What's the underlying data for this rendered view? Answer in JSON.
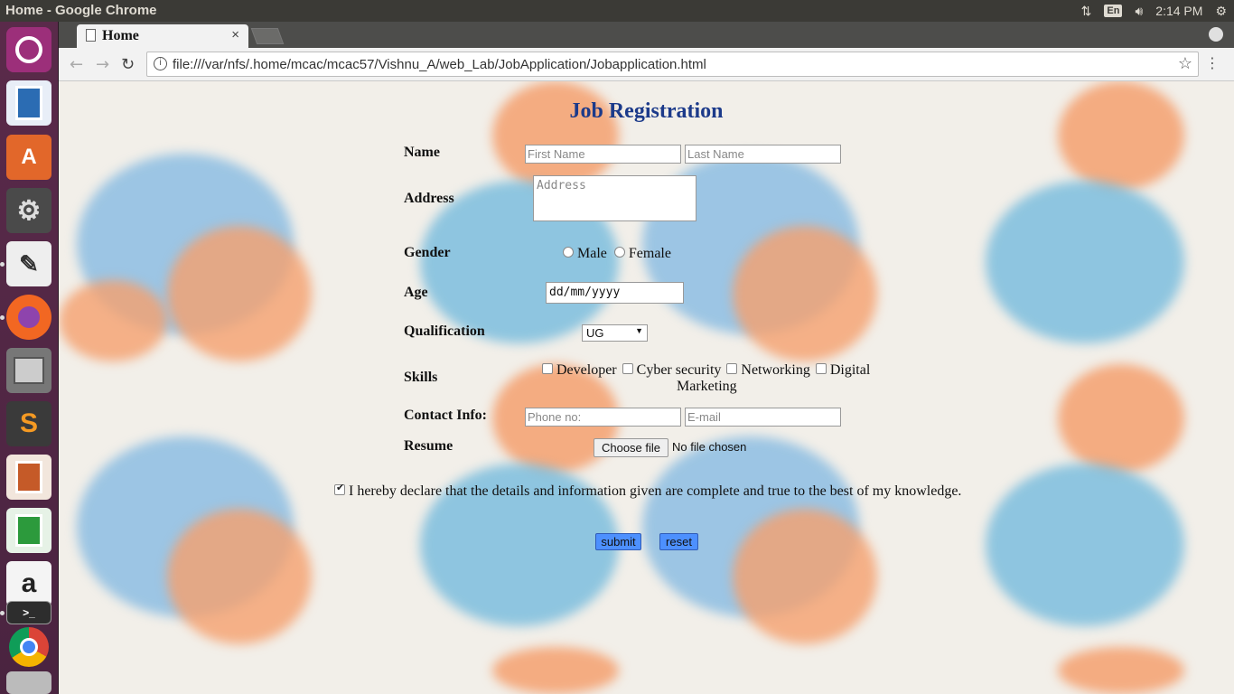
{
  "window": {
    "title": "Home - Google Chrome",
    "clock": "2:14 PM",
    "keyboard": "En"
  },
  "launcher": {
    "icons": [
      "ubuntu-icon",
      "writer-icon",
      "software-center-icon",
      "settings-icon",
      "text-editor-icon",
      "firefox-icon",
      "files-icon",
      "sublime-icon",
      "impress-icon",
      "calc-icon",
      "amazon-icon",
      "terminal-icon",
      "chrome-icon",
      "drive-icon"
    ]
  },
  "browser": {
    "tab_title": "Home",
    "tab_close": "×",
    "url": "file:///var/nfs/.home/mcac/mcac57/Vishnu_A/web_Lab/JobApplication/Jobapplication.html"
  },
  "form": {
    "title": "Job Registration",
    "name_label": "Name",
    "first_name_placeholder": "First Name",
    "last_name_placeholder": "Last Name",
    "address_label": "Address",
    "address_placeholder": "Address",
    "gender_label": "Gender",
    "gender_male": "Male",
    "gender_female": "Female",
    "age_label": "Age",
    "age_value": "dd/mm/yyyy",
    "qualification_label": "Qualification",
    "qualification_value": "UG",
    "skills_label": "Skills",
    "skill_developer": "Developer",
    "skill_cyber": "Cyber security",
    "skill_networking": "Networking",
    "skill_digital": "Digital",
    "skill_marketing": "Marketing",
    "contact_label": "Contact Info:",
    "phone_placeholder": "Phone no:",
    "email_placeholder": "E-mail",
    "resume_label": "Resume",
    "choose_file": "Choose file",
    "no_file": "No file chosen",
    "declaration": "I hereby declare that the details and information given are complete and true to the best of my knowledge.",
    "submit": "submit",
    "reset": "reset"
  },
  "colors": {
    "title": "#1c3a8a",
    "button": "#4d90fe",
    "launcher": "#5a2a4a"
  }
}
